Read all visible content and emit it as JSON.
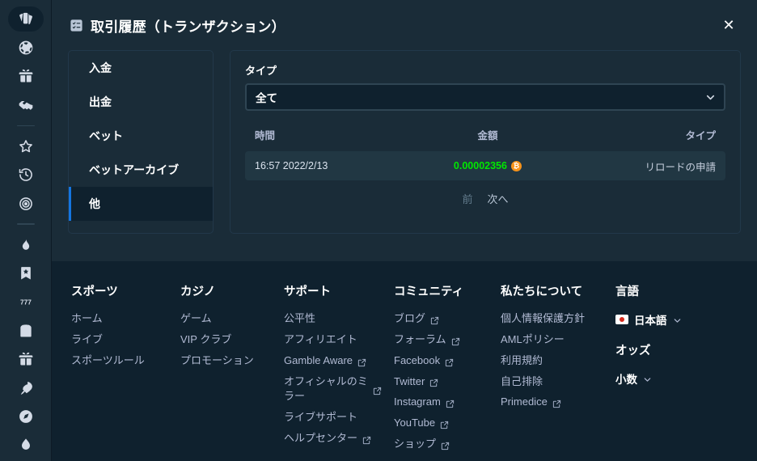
{
  "rail": {
    "items": [
      {
        "name": "cards-icon",
        "active": true
      },
      {
        "name": "sports-ball-icon",
        "active": false
      },
      {
        "name": "gift-icon",
        "active": false
      },
      {
        "name": "handshake-icon",
        "active": false
      },
      {
        "name": "divider",
        "active": false
      },
      {
        "name": "star-icon",
        "active": false
      },
      {
        "name": "history-clock-icon",
        "active": false
      },
      {
        "name": "target-icon",
        "active": false
      },
      {
        "name": "divider",
        "active": false
      },
      {
        "name": "flame-icon",
        "active": false
      },
      {
        "name": "bookmark-star-icon",
        "active": false
      },
      {
        "name": "slots-777-icon",
        "active": false
      },
      {
        "name": "jersey-icon",
        "active": false
      },
      {
        "name": "gift-box-icon",
        "active": false
      },
      {
        "name": "rocket-icon",
        "active": false
      },
      {
        "name": "compass-icon",
        "active": false
      },
      {
        "name": "water-drop-icon",
        "active": false
      }
    ]
  },
  "modal": {
    "title": "取引履歴（トランザクション）",
    "title_icon": "task-list-icon",
    "close_label": "✕",
    "menu": [
      {
        "label": "入金",
        "active": false
      },
      {
        "label": "出金",
        "active": false
      },
      {
        "label": "ベット",
        "active": false
      },
      {
        "label": "ベットアーカイブ",
        "active": false
      },
      {
        "label": "他",
        "active": true
      }
    ],
    "filter": {
      "label": "タイプ",
      "selected": "全て",
      "options": [
        "全て"
      ]
    },
    "table": {
      "columns": [
        "時間",
        "金額",
        "タイプ"
      ],
      "rows": [
        {
          "time": "16:57 2022/2/13",
          "amount": "0.00002356",
          "currency_symbol": "₿",
          "currency_color": "#f7931a",
          "amount_color": "#00e701",
          "type": "リロードの申請"
        }
      ]
    },
    "pagination": {
      "prev": "前",
      "next": "次へ"
    }
  },
  "footer": {
    "columns": [
      {
        "title": "スポーツ",
        "links": [
          {
            "label": "ホーム",
            "external": false
          },
          {
            "label": "ライブ",
            "external": false
          },
          {
            "label": "スポーツルール",
            "external": false
          }
        ]
      },
      {
        "title": "カジノ",
        "links": [
          {
            "label": "ゲーム",
            "external": false
          },
          {
            "label": "VIP クラブ",
            "external": false
          },
          {
            "label": "プロモーション",
            "external": false
          }
        ]
      },
      {
        "title": "サポート",
        "links": [
          {
            "label": "公平性",
            "external": false
          },
          {
            "label": "アフィリエイト",
            "external": false
          },
          {
            "label": "Gamble Aware",
            "external": true
          },
          {
            "label": "オフィシャルのミラー",
            "external": true
          },
          {
            "label": "ライブサポート",
            "external": false
          },
          {
            "label": "ヘルプセンター",
            "external": true
          }
        ]
      },
      {
        "title": "コミュニティ",
        "links": [
          {
            "label": "ブログ",
            "external": true
          },
          {
            "label": "フォーラム",
            "external": true
          },
          {
            "label": "Facebook",
            "external": true
          },
          {
            "label": "Twitter",
            "external": true
          },
          {
            "label": "Instagram",
            "external": true
          },
          {
            "label": "YouTube",
            "external": true
          },
          {
            "label": "ショップ",
            "external": true
          }
        ]
      },
      {
        "title": "私たちについて",
        "links": [
          {
            "label": "個人情報保護方針",
            "external": false
          },
          {
            "label": "AMLポリシー",
            "external": false
          },
          {
            "label": "利用規約",
            "external": false
          },
          {
            "label": "自己排除",
            "external": false
          },
          {
            "label": "Primedice",
            "external": true
          }
        ]
      }
    ],
    "language": {
      "title": "言語",
      "selected": "日本語",
      "flag": "japan-flag-icon"
    },
    "odds": {
      "title": "オッズ",
      "selected": "小数"
    }
  },
  "colors": {
    "page_bg": "#0f212e",
    "modal_bg": "#1a2c38",
    "row_bg": "#213743",
    "accent_blue": "#1475e1",
    "green": "#00e701",
    "bitcoin_orange": "#f7931a",
    "muted_text": "#b1bad3"
  }
}
